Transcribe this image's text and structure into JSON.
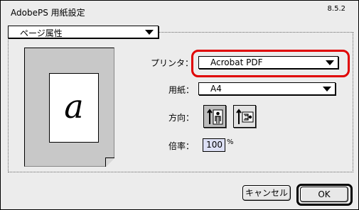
{
  "window": {
    "title": "AdobePS 用紙設定",
    "version": "8.5.2"
  },
  "section_popup": {
    "value": "ページ属性"
  },
  "preview": {
    "glyph": "a"
  },
  "printer": {
    "label": "プリンタ：",
    "value": "Acrobat PDF"
  },
  "paper": {
    "label": "用紙：",
    "value": "A4"
  },
  "orientation": {
    "label": "方向：",
    "options": [
      "portrait-icon",
      "landscape-icon"
    ],
    "selected": "portrait"
  },
  "scale": {
    "label": "倍率：",
    "value": "100",
    "unit": "%"
  },
  "buttons": {
    "cancel": "キャンセル",
    "ok": "OK"
  },
  "colors": {
    "highlight": "#e00000",
    "field_bg": "#dde0f5"
  }
}
